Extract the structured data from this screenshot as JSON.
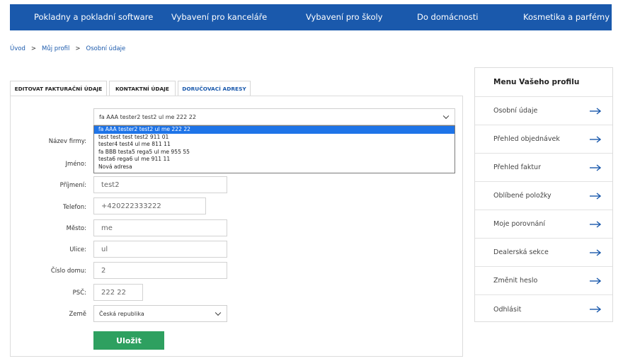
{
  "topnav": {
    "items": [
      "Pokladny a pokladní software",
      "Vybavení pro kanceláře",
      "Vybavení pro školy",
      "Do domácnosti",
      "Kosmetika a parfémy"
    ]
  },
  "breadcrumb": {
    "items": [
      "Úvod",
      "Můj profil",
      "Osobní údaje"
    ],
    "separator": ">"
  },
  "tabs": [
    {
      "label": "EDITOVAT FAKTURAČNÍ ÚDAJE",
      "active": false
    },
    {
      "label": "KONTAKTNÍ ÚDAJE",
      "active": false
    },
    {
      "label": "DORUČOVACÍ ADRESY",
      "active": true
    }
  ],
  "address_select": {
    "value": "fa AAA tester2 test2 ul me 222 22",
    "options": [
      "fa AAA tester2 test2 ul me 222 22",
      "test test test test2 911 01",
      "tester4 test4 ul me 811 11",
      "fa BBB testa5 rega5 ul me 955 55",
      "testa6 rega6 ul me 911 11",
      "Nová adresa"
    ]
  },
  "form": {
    "firm_label": "Název firmy:",
    "first_name_label": "Jméno:",
    "last_name_label": "Příjmení:",
    "last_name_value": "test2",
    "phone_label": "Telefon:",
    "phone_value": "+420222333222",
    "city_label": "Město:",
    "city_value": "me",
    "street_label": "Ulice:",
    "street_value": "ul",
    "house_label": "Číslo domu:",
    "house_value": "2",
    "zip_label": "PSČ:",
    "zip_value": "222 22",
    "country_label": "Země",
    "country_value": "Česká republika",
    "save_label": "Uložit"
  },
  "sidebar": {
    "title": "Menu Vašeho profilu",
    "items": [
      "Osobní údaje",
      "Přehled objednávek",
      "Přehled faktur",
      "Oblíbené položky",
      "Moje porovnání",
      "Dealerská sekce",
      "Změnit heslo",
      "Odhlásit"
    ]
  },
  "colors": {
    "brand_blue": "#1a59ac",
    "save_green": "#2ea060",
    "selected_option": "#1e74e8"
  }
}
